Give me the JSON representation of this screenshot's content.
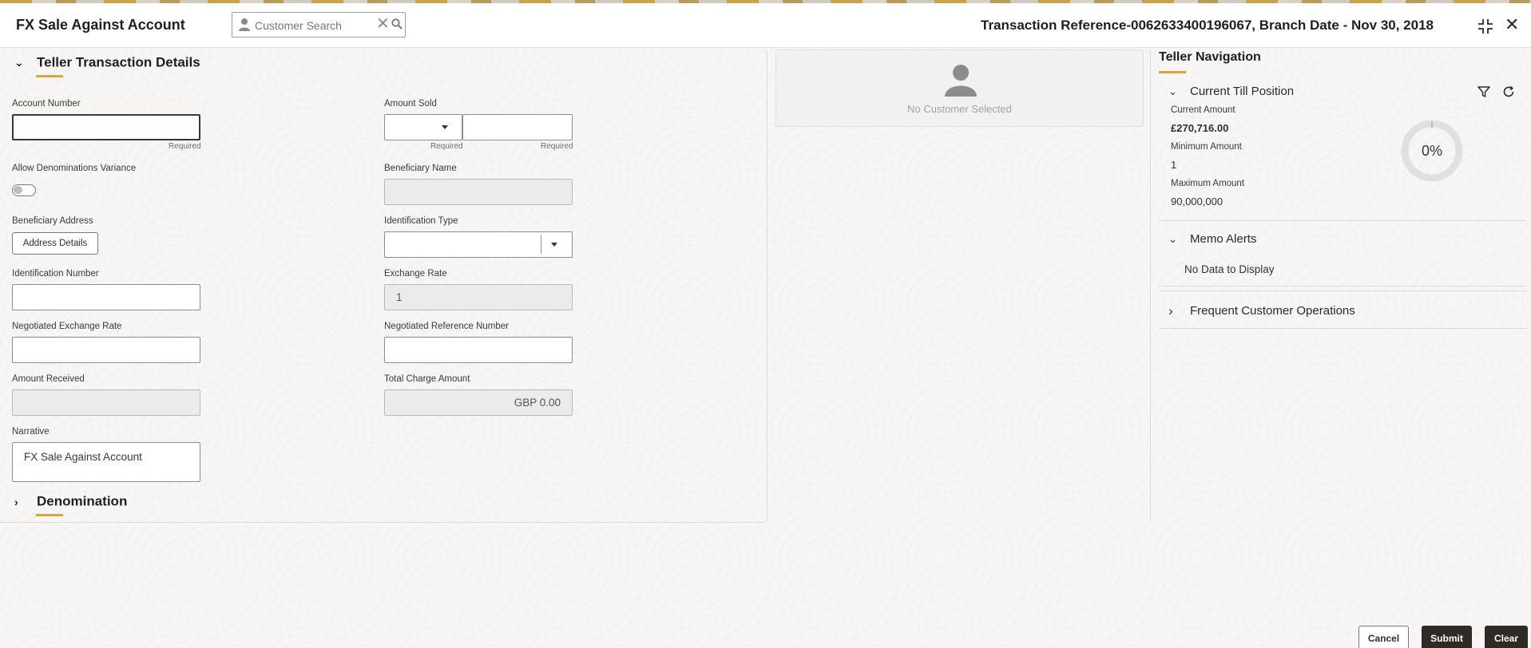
{
  "header": {
    "title": "FX Sale Against Account",
    "search_placeholder": "Customer Search",
    "transaction_info": "Transaction Reference-0062633400196067, Branch Date - Nov 30, 2018"
  },
  "form": {
    "section_title": "Teller Transaction Details",
    "required_label": "Required",
    "fields": {
      "account_number": {
        "label": "Account Number",
        "value": ""
      },
      "amount_sold": {
        "label": "Amount Sold",
        "currency": "",
        "value": ""
      },
      "allow_denominations_variance": {
        "label": "Allow Denominations Variance",
        "on": false
      },
      "beneficiary_name": {
        "label": "Beneficiary Name",
        "value": ""
      },
      "beneficiary_address": {
        "label": "Beneficiary Address",
        "button_label": "Address Details"
      },
      "identification_type": {
        "label": "Identification Type",
        "value": ""
      },
      "identification_number": {
        "label": "Identification Number",
        "value": ""
      },
      "exchange_rate": {
        "label": "Exchange Rate",
        "value": "1"
      },
      "negotiated_exchange_rate": {
        "label": "Negotiated Exchange Rate",
        "value": ""
      },
      "negotiated_reference_number": {
        "label": "Negotiated Reference Number",
        "value": ""
      },
      "amount_received": {
        "label": "Amount Received",
        "value": ""
      },
      "total_charge_amount": {
        "label": "Total Charge Amount",
        "value": "GBP 0.00"
      },
      "narrative": {
        "label": "Narrative",
        "value": "FX Sale Against Account"
      }
    },
    "denomination_title": "Denomination"
  },
  "customer": {
    "no_customer_text": "No Customer Selected"
  },
  "nav": {
    "title": "Teller Navigation",
    "till": {
      "title": "Current Till Position",
      "current_amount_label": "Current Amount",
      "current_amount": "£270,716.00",
      "minimum_amount_label": "Minimum Amount",
      "minimum_amount": "1",
      "maximum_amount_label": "Maximum Amount",
      "maximum_amount": "90,000,000",
      "utilization": "0%",
      "utilization_fraction": 0
    },
    "memo_alerts": {
      "title": "Memo Alerts",
      "empty_text": "No Data to Display"
    },
    "frequent_ops": {
      "title": "Frequent Customer Operations"
    }
  },
  "footer": {
    "cancel": "Cancel",
    "submit": "Submit",
    "clear": "Clear"
  },
  "colors": {
    "accent": "#e0a33b",
    "primary_button": "#2e2a26"
  }
}
